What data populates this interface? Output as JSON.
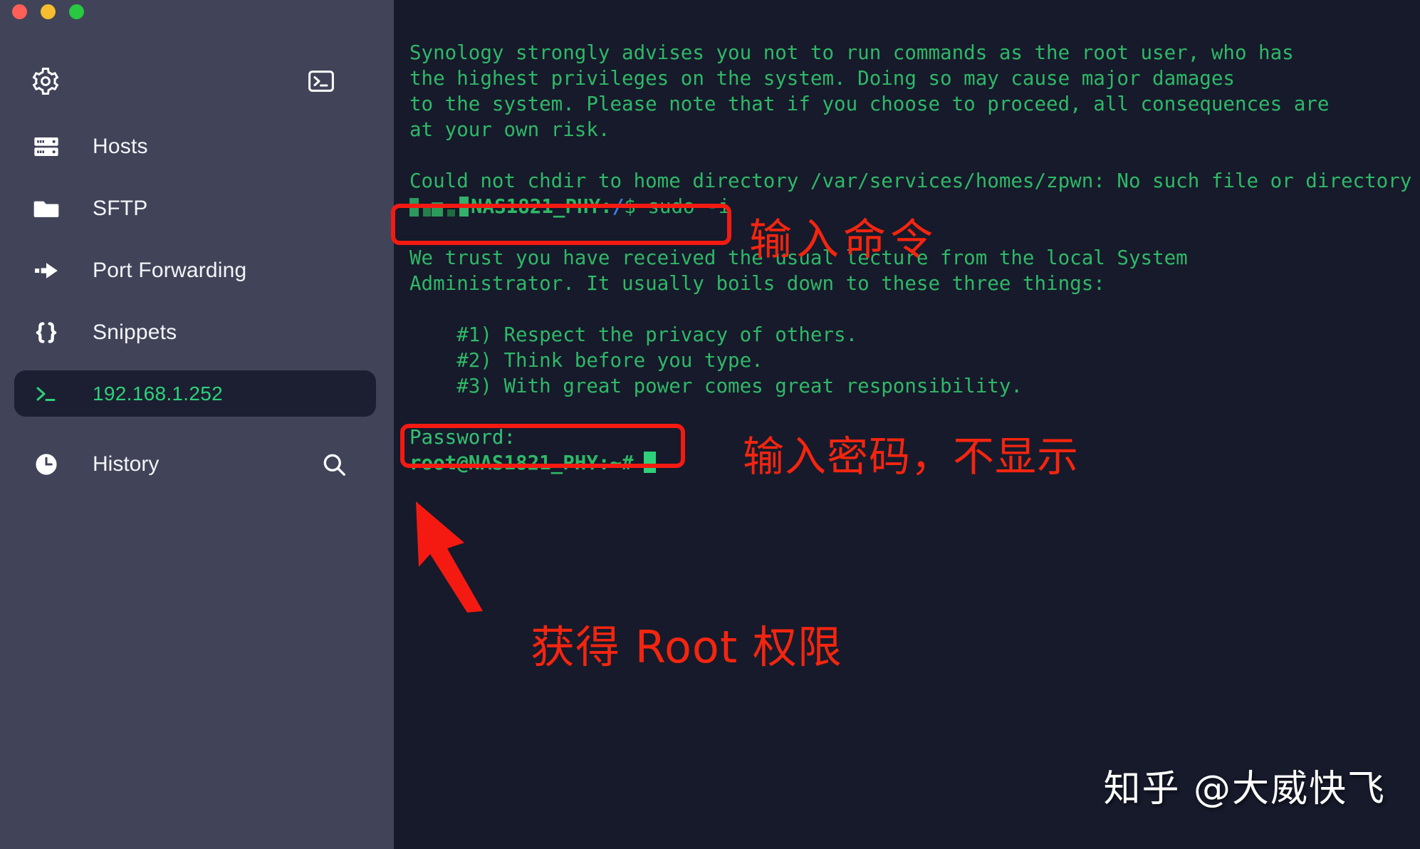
{
  "window": {
    "traffic_lights": [
      {
        "name": "close",
        "color": "#ff5f57"
      },
      {
        "name": "minimize",
        "color": "#f6bd30"
      },
      {
        "name": "maximize",
        "color": "#28c840"
      }
    ]
  },
  "sidebar": {
    "background_color": "#414458",
    "toolbar": {
      "settings_icon": "gear-icon",
      "new_terminal_icon": "terminal-icon"
    },
    "items": [
      {
        "label": "Hosts",
        "icon": "server-rack-icon"
      },
      {
        "label": "SFTP",
        "icon": "folder-icon"
      },
      {
        "label": "Port Forwarding",
        "icon": "arrow-forward-icon"
      },
      {
        "label": "Snippets",
        "icon": "curly-braces-icon"
      }
    ],
    "active_session": {
      "label": "192.168.1.252",
      "icon": "prompt-icon",
      "color": "#2fd07a",
      "background_color": "#1b1f31"
    },
    "history": {
      "label": "History",
      "icon": "clock-icon",
      "search_icon": "search-icon"
    }
  },
  "terminal": {
    "background_color": "#161a2b",
    "text_color": "#2fb866",
    "lines": [
      "Synology strongly advises you not to run commands as the root user, who has",
      "the highest privileges on the system. Doing so may cause major damages",
      "to the system. Please note that if you choose to proceed, all consequences are",
      "at your own risk.",
      "",
      "Could not chdir to home directory /var/services/homes/zpwn: No such file or directory"
    ],
    "prompt_line": {
      "user_masked": true,
      "host": "NAS1821_PHY:",
      "path": "/",
      "command": "$ sudo -i"
    },
    "sudo_lecture": [
      "We trust you have received the usual lecture from the local System",
      "Administrator. It usually boils down to these three things:",
      "",
      "    #1) Respect the privacy of others.",
      "    #2) Think before you type.",
      "    #3) With great power comes great responsibility."
    ],
    "password_prompt": "Password:",
    "root_prompt": "root@NAS1821_PHY:~#",
    "cursor": "block"
  },
  "annotations": {
    "color": "#f4250f",
    "command_label": "输入命令",
    "password_label": "输入密码，不显示",
    "root_label": "获得 Root 权限",
    "arrow": "arrow-up-left-icon"
  },
  "watermark": {
    "text": "知乎 @大威快飞"
  }
}
